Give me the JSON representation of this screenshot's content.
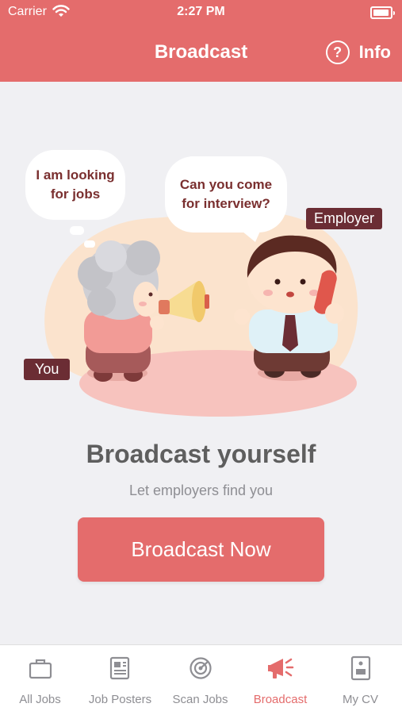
{
  "status_bar": {
    "carrier": "Carrier",
    "time": "2:27 PM"
  },
  "header": {
    "title": "Broadcast",
    "info_label": "Info"
  },
  "illustration": {
    "bubble_you": "I am looking for jobs",
    "bubble_employer": "Can you come for interview?",
    "tag_employer": "Employer",
    "tag_you": "You"
  },
  "content": {
    "headline": "Broadcast yourself",
    "subline": "Let employers find you",
    "cta_label": "Broadcast Now"
  },
  "tabs": [
    {
      "label": "All Jobs",
      "icon": "briefcase-icon",
      "active": false
    },
    {
      "label": "Job Posters",
      "icon": "newspaper-icon",
      "active": false
    },
    {
      "label": "Scan Jobs",
      "icon": "radar-icon",
      "active": false
    },
    {
      "label": "Broadcast",
      "icon": "megaphone-icon",
      "active": true
    },
    {
      "label": "My CV",
      "icon": "id-card-icon",
      "active": false
    }
  ],
  "colors": {
    "accent": "#e46c6c",
    "tag_bg": "#6b2d34",
    "bubble_text": "#7a2f2f"
  }
}
